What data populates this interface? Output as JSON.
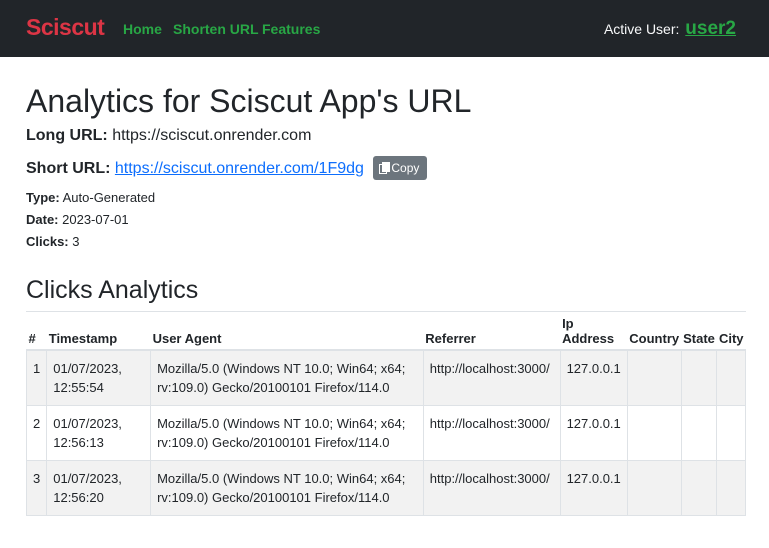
{
  "navbar": {
    "brand": "Sciscut",
    "links": [
      "Home",
      "Shorten URL",
      "Features"
    ],
    "active_user_label": "Active User:",
    "active_user": "user2"
  },
  "page": {
    "title": "Analytics for Sciscut App's URL",
    "long_url_label": "Long URL:",
    "long_url": "https://sciscut.onrender.com",
    "short_url_label": "Short URL:",
    "short_url": "https://sciscut.onrender.com/1F9dg",
    "copy_label": "Copy",
    "type_label": "Type:",
    "type": "Auto-Generated",
    "date_label": "Date:",
    "date": "2023-07-01",
    "clicks_label": "Clicks:",
    "clicks": "3"
  },
  "analytics": {
    "heading": "Clicks Analytics",
    "columns": [
      "#",
      "Timestamp",
      "User Agent",
      "Referrer",
      "Ip Address",
      "Country",
      "State",
      "City"
    ],
    "rows": [
      {
        "num": "1",
        "timestamp": "01/07/2023, 12:55:54",
        "user_agent": "Mozilla/5.0 (Windows NT 10.0; Win64; x64; rv:109.0) Gecko/20100101 Firefox/114.0",
        "referrer": "http://localhost:3000/",
        "ip": "127.0.0.1",
        "country": "",
        "state": "",
        "city": ""
      },
      {
        "num": "2",
        "timestamp": "01/07/2023, 12:56:13",
        "user_agent": "Mozilla/5.0 (Windows NT 10.0; Win64; x64; rv:109.0) Gecko/20100101 Firefox/114.0",
        "referrer": "http://localhost:3000/",
        "ip": "127.0.0.1",
        "country": "",
        "state": "",
        "city": ""
      },
      {
        "num": "3",
        "timestamp": "01/07/2023, 12:56:20",
        "user_agent": "Mozilla/5.0 (Windows NT 10.0; Win64; x64; rv:109.0) Gecko/20100101 Firefox/114.0",
        "referrer": "http://localhost:3000/",
        "ip": "127.0.0.1",
        "country": "",
        "state": "",
        "city": ""
      }
    ]
  }
}
